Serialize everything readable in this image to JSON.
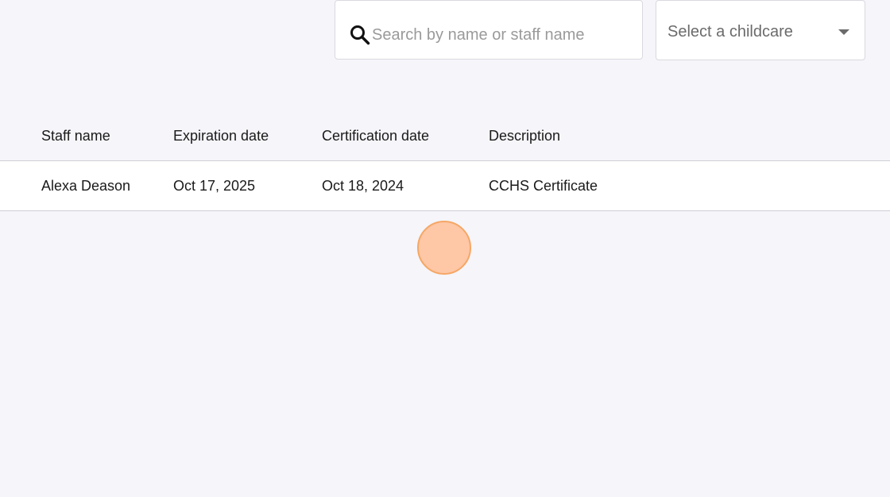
{
  "search": {
    "placeholder": "Search by name or staff name",
    "value": ""
  },
  "childcare_select": {
    "selected_label": "Select a childcare"
  },
  "table": {
    "columns": [
      "Staff name",
      "Expiration date",
      "Certification date",
      "Description"
    ],
    "rows": [
      [
        "Alexa Deason",
        "Oct 17, 2025",
        "Oct 18, 2024",
        "CCHS Certificate"
      ]
    ]
  },
  "icons": {
    "search": "search-icon",
    "dropdown": "chevron-down-icon"
  },
  "colors": {
    "page_background": "#f5f5fa",
    "row_background": "#ffffff",
    "cursor_fill": "#ffbe96",
    "cursor_border": "#f5a765"
  }
}
